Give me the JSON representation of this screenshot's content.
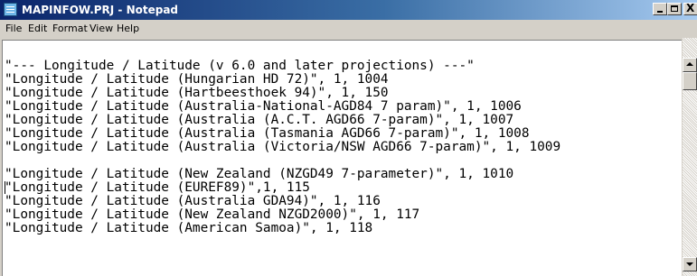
{
  "window": {
    "title": "MAPINFOW.PRJ - Notepad",
    "controls": {
      "minimize": "_",
      "maximize": "□",
      "close": "X"
    }
  },
  "menubar": {
    "items": [
      "File",
      "Edit",
      "Format",
      "View",
      "Help"
    ]
  },
  "editor": {
    "lines": [
      "\"--- Longitude / Latitude (v 6.0 and later projections) ---\"",
      "\"Longitude / Latitude (Hungarian HD 72)\", 1, 1004",
      "\"Longitude / Latitude (Hartbeesthoek 94)\", 1, 150",
      "\"Longitude / Latitude (Australia-National-AGD84 7 param)\", 1, 1006",
      "\"Longitude / Latitude (Australia (A.C.T. AGD66 7-param)\", 1, 1007",
      "\"Longitude / Latitude (Australia (Tasmania AGD66 7-param)\", 1, 1008",
      "\"Longitude / Latitude (Australia (Victoria/NSW AGD66 7-param)\", 1, 1009",
      "",
      "\"Longitude / Latitude (New Zealand (NZGD49 7-parameter)\", 1, 1010",
      "\"Longitude / Latitude (EUREF89)\",1, 115",
      "\"Longitude / Latitude (Australia GDA94)\", 1, 116",
      "\"Longitude / Latitude (New Zealand NZGD2000)\", 1, 117",
      "\"Longitude / Latitude (American Samoa)\", 1, 118"
    ]
  },
  "colors": {
    "titlebar_start": "#0a246a",
    "titlebar_end": "#a6caf0",
    "chrome": "#d4d0c8",
    "text": "#000000",
    "background": "#ffffff"
  },
  "icons": {
    "app": "notepad-icon",
    "scroll_up": "arrow-up-icon",
    "scroll_down": "arrow-down-icon"
  }
}
